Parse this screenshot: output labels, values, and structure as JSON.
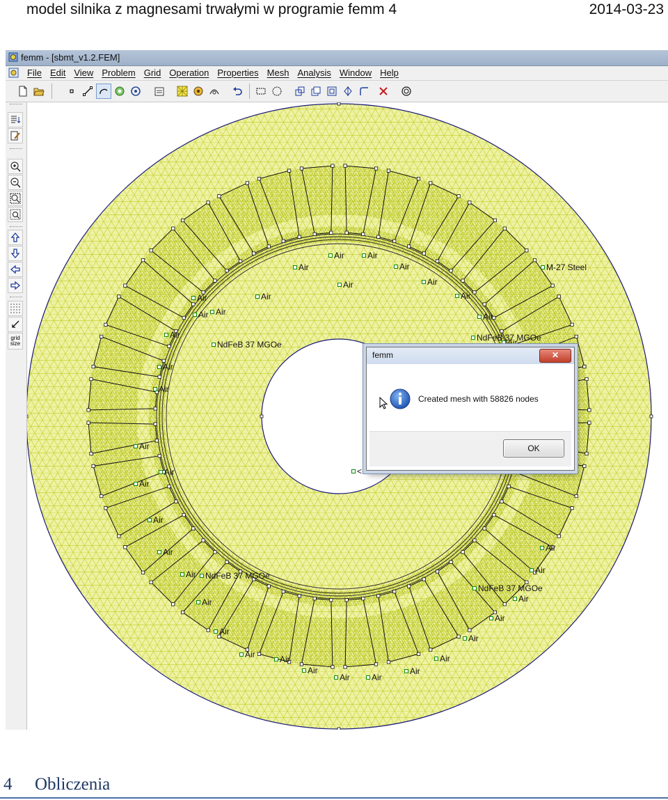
{
  "page_header": {
    "title": "model silnika z magnesami trwałymi w programie femm 4",
    "date": "2014-03-23"
  },
  "window": {
    "title": "femm - [sbmt_v1.2.FEM]"
  },
  "menu": {
    "items": [
      "File",
      "Edit",
      "View",
      "Problem",
      "Grid",
      "Operation",
      "Properties",
      "Mesh",
      "Analysis",
      "Window",
      "Help"
    ]
  },
  "toolbar": {
    "icons": [
      "new-file-icon",
      "open-file-icon",
      "node-mode-icon",
      "segment-mode-icon",
      "arc-mode-icon",
      "block-label-mode-icon",
      "group-mode-icon",
      "properties-icon",
      "mesh-icon",
      "run-analysis-icon",
      "view-results-icon",
      "undo-icon",
      "select-window-icon",
      "select-radius-icon",
      "move-icon",
      "copy-icon",
      "scale-icon",
      "mirror-icon",
      "fillet-icon",
      "delete-icon",
      "circle-icon"
    ]
  },
  "sidebar": {
    "grid_label_1": "grid",
    "grid_label_2": "size"
  },
  "canvas_labels": {
    "air": "Air",
    "steel": "M-27 Steel",
    "magnet": "NdFeB 37 MGOe",
    "truncated": "<No"
  },
  "dialog": {
    "title": "femm",
    "close": "✕",
    "message": "Created mesh with 58826 nodes",
    "ok": "OK"
  },
  "section": {
    "number": "4",
    "title": "Obliczenia"
  },
  "colors": {
    "mesh_fill": "#eef2a2",
    "mesh_line": "#c9d23a",
    "outline": "#1a1a7a",
    "heading": "#1f3864"
  }
}
